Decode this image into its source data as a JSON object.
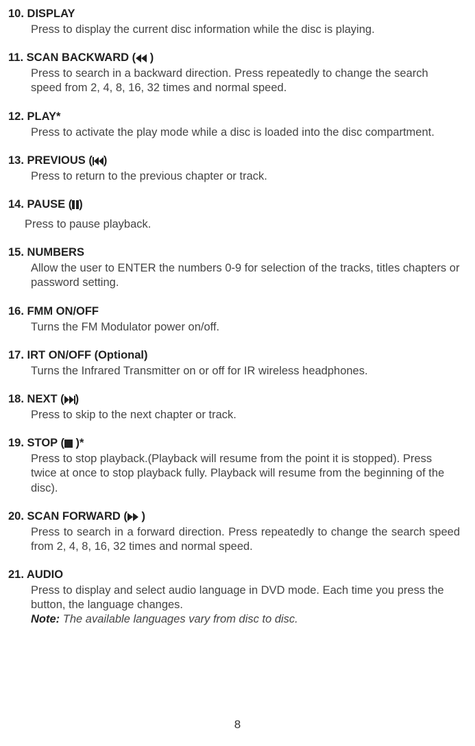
{
  "items": [
    {
      "num": "10.",
      "title": "DISPLAY",
      "icon": null,
      "iconSuffix": "",
      "desc": "Press to display the current disc information while the disc is playing.",
      "descClass": "desc justify",
      "titlePrefix": "  "
    },
    {
      "num": "11.",
      "title": "SCAN BACKWARD (",
      "icon": "scan-backward",
      "iconSuffix": " )",
      "desc": "Press to search in a backward direction. Press repeatedly to change the search speed from 2, 4, 8, 16, 32 times and normal speed.",
      "descClass": "desc",
      "titlePrefix": " "
    },
    {
      "num": "12.",
      "title": "PLAY*",
      "icon": null,
      "iconSuffix": "",
      "desc": "Press to activate the play mode while a disc is loaded into the disc compartment.",
      "descClass": "desc",
      "titlePrefix": "  "
    },
    {
      "num": "13.",
      "title": "PREVIOUS (",
      "icon": "previous",
      "iconSuffix": ")",
      "desc": "Press to return to the previous chapter or track.",
      "descClass": "desc",
      "titlePrefix": "  "
    },
    {
      "num": "14.",
      "title": "PAUSE (",
      "icon": "pause",
      "iconSuffix": ")",
      "desc": "Press to pause playback.",
      "descClass": "desc pause",
      "titlePrefix": " "
    },
    {
      "num": "15.",
      "title": "NUMBERS",
      "icon": null,
      "iconSuffix": "",
      "desc": "Allow the user to ENTER the numbers 0-9 for selection of the tracks, titles chapters or password setting.",
      "descClass": "desc",
      "titlePrefix": "  "
    },
    {
      "num": "16.",
      "title": "FMM ON/OFF",
      "icon": null,
      "iconSuffix": "",
      "desc": "Turns the FM Modulator power on/off.",
      "descClass": "desc",
      "titlePrefix": "  "
    },
    {
      "num": "17.",
      "title": "IRT ON/OFF (Optional)",
      "icon": null,
      "iconSuffix": "",
      "desc": "Turns the Infrared Transmitter on or off for IR wireless headphones.",
      "descClass": "desc",
      "titlePrefix": "  "
    },
    {
      "num": "18.",
      "title": "NEXT (",
      "icon": "next",
      "iconSuffix": ")",
      "desc": "Press to skip to the next chapter or track.",
      "descClass": "desc",
      "titlePrefix": "  "
    },
    {
      "num": "19.",
      "title": "STOP (",
      "icon": "stop",
      "iconSuffix": " )*",
      "desc": "Press to stop playback.(Playback will resume from the point it is stopped). Press twice at once to stop playback fully. Playback will resume from the beginning of the disc).",
      "descClass": "desc",
      "titlePrefix": "  "
    },
    {
      "num": "20.",
      "title": "SCAN FORWARD (",
      "icon": "scan-forward",
      "iconSuffix": " )",
      "desc": "Press to search in a forward direction. Press repeatedly to change the search speed from 2, 4, 8, 16, 32 times and normal speed.",
      "descClass": "desc justify",
      "titlePrefix": " "
    },
    {
      "num": "21.",
      "title": "AUDIO",
      "icon": null,
      "iconSuffix": "",
      "desc": "Press to display and select  audio language in DVD mode. Each time you press the button, the language changes.",
      "descClass": "desc",
      "titlePrefix": "  ",
      "noteLabel": "Note:",
      "noteText": " The available languages vary from disc to disc."
    }
  ],
  "pageNumber": "8"
}
